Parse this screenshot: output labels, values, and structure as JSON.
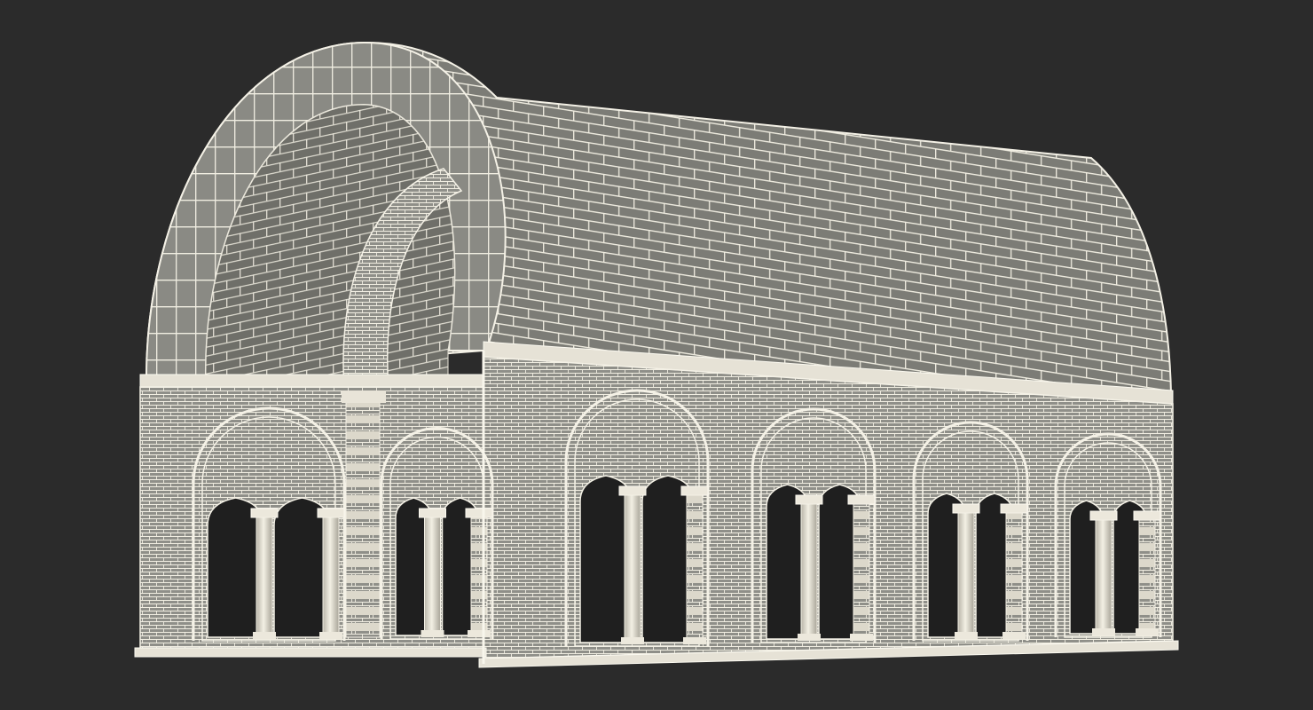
{
  "scene": {
    "subject": "barrel-vaulted-arcade-wireframe",
    "colors": {
      "background": "#2b2b2b",
      "wire": "#f4f1e6",
      "brick_fill": "#8d8d87",
      "vault_fill": "#7a7a74",
      "vault_inner": "#6e6e68",
      "shadow": "#1a1a1a"
    }
  }
}
